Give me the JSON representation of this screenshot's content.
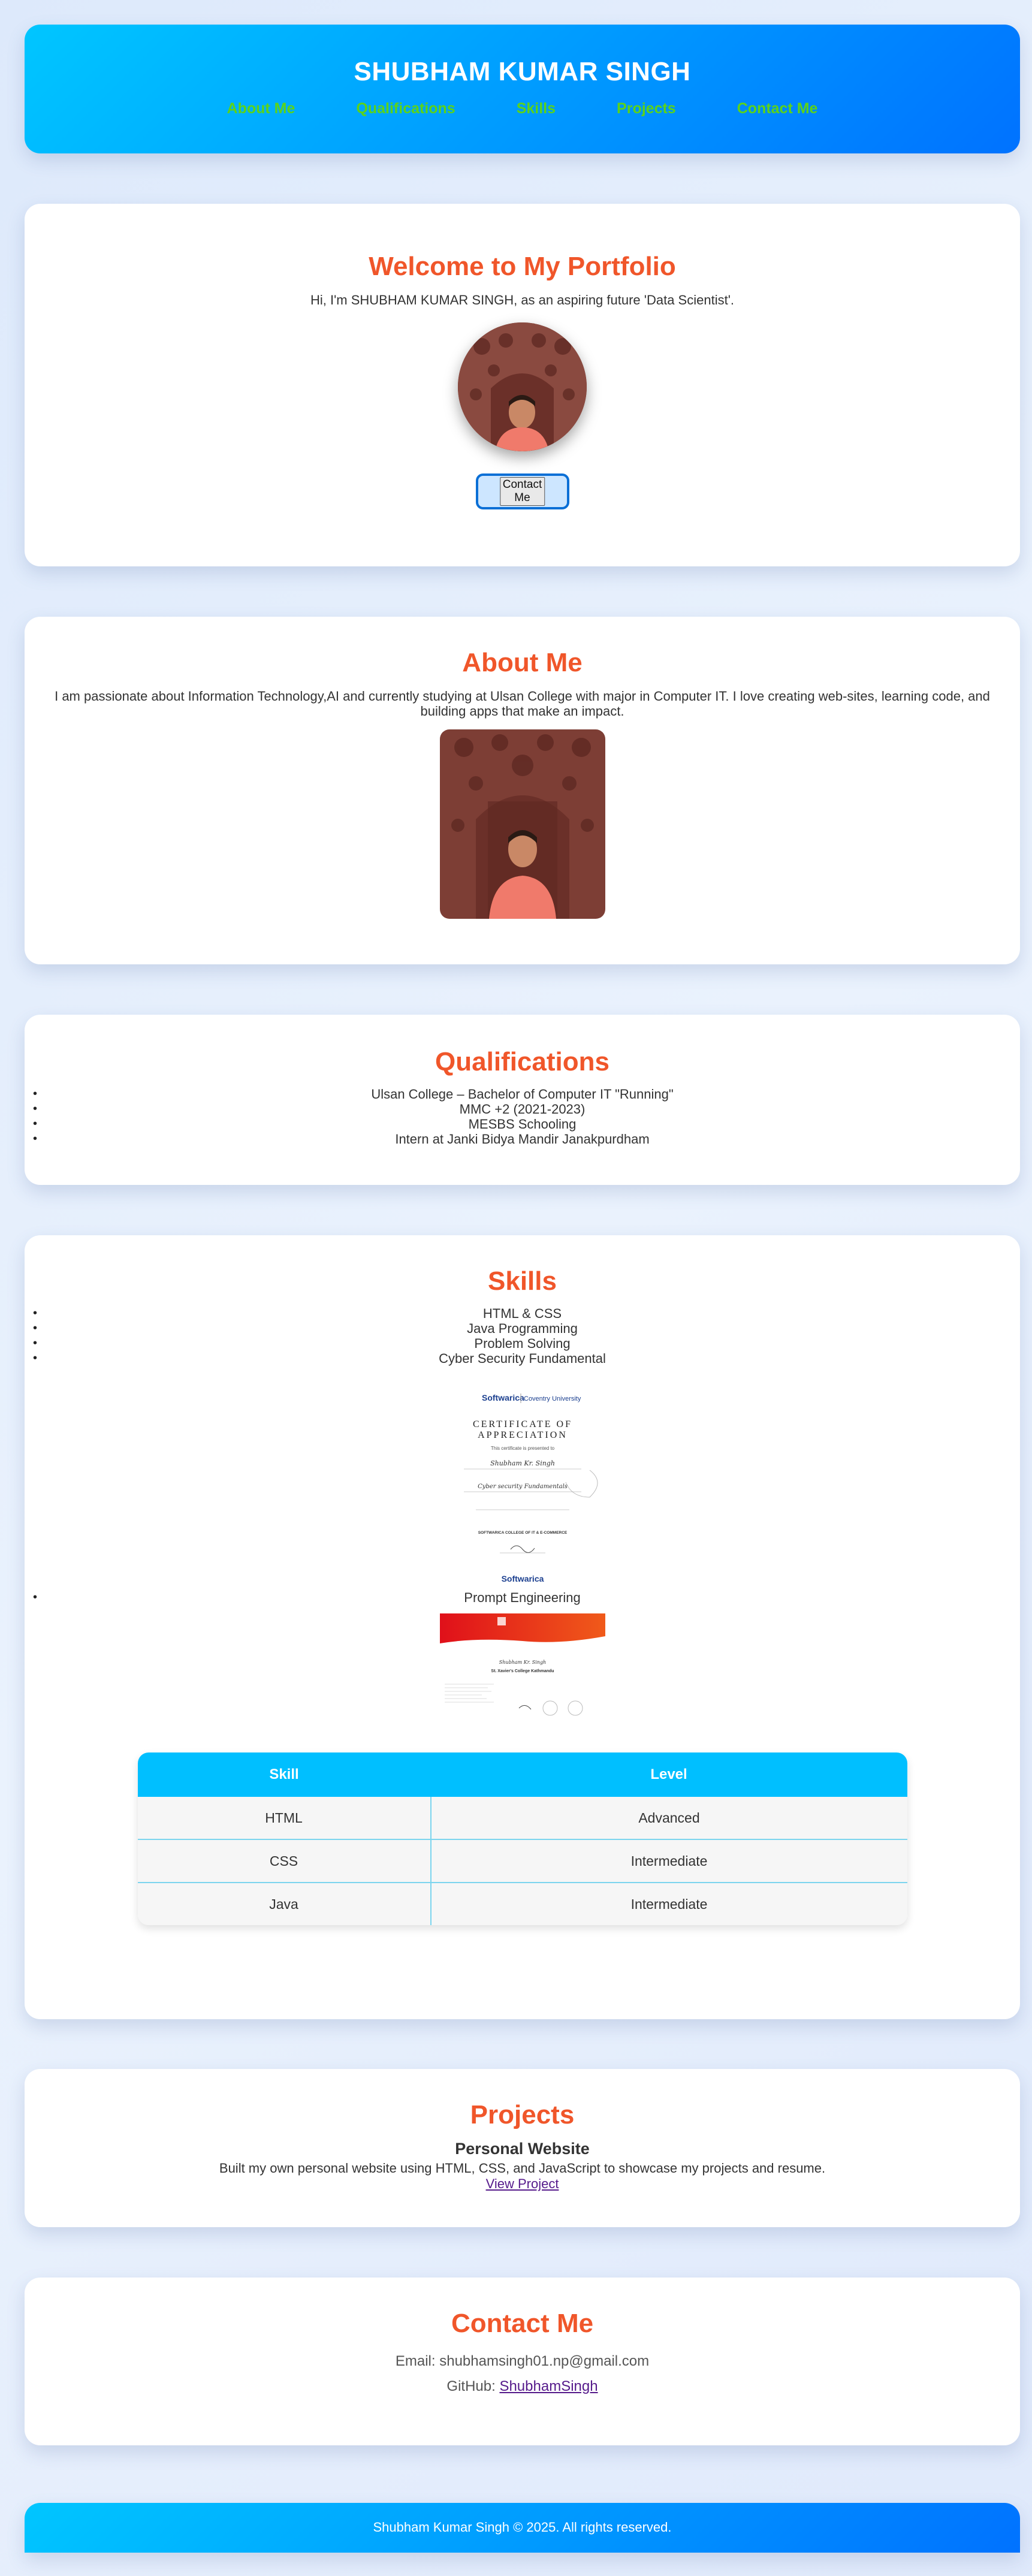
{
  "header": {
    "title": "SHUBHAM KUMAR SINGH",
    "nav": [
      "About Me",
      "Qualifications",
      "Skills",
      "Projects",
      "Contact Me"
    ]
  },
  "welcome": {
    "heading": "Welcome to My Portfolio",
    "intro": "Hi, I'm SHUBHAM KUMAR SINGH, as an aspiring future 'Data Scientist'.",
    "button_label": "Contact Me"
  },
  "about": {
    "heading": "About Me",
    "text": "I am passionate about Information Technology,AI and currently studying at Ulsan College with major in Computer IT. I love creating web-sites, learning code, and building apps that make an impact."
  },
  "qualifications": {
    "heading": "Qualifications",
    "items": [
      "Ulsan College – Bachelor of Computer IT \"Running\"",
      "MMC +2 (2021-2023)",
      "MESBS Schooling",
      "Intern at Janki Bidya Mandir Janakpurdham"
    ]
  },
  "skills": {
    "heading": "Skills",
    "items": [
      "HTML & CSS",
      "Java Programming",
      "Problem Solving",
      "Cyber Security Fundamental"
    ],
    "extra_item": "Prompt Engineering",
    "cert1": {
      "brand": "Softwarica",
      "partner": "Coventry University",
      "title1": "CERTIFICATE OF",
      "title2": "APPRECIATION",
      "line": "This certificate is presented to",
      "name": "Shubham Kr. Singh",
      "course": "Cyber security Fundamentals",
      "footer": "SOFTWARICA COLLEGE OF IT & E-COMMERCE"
    },
    "cert2": {
      "name": "Shubham Kr. Singh",
      "college": "St. Xavier's College Kathmandu"
    },
    "table": {
      "headers": [
        "Skill",
        "Level"
      ],
      "rows": [
        [
          "HTML",
          "Advanced"
        ],
        [
          "CSS",
          "Intermediate"
        ],
        [
          "Java",
          "Intermediate"
        ]
      ]
    }
  },
  "projects": {
    "heading": "Projects",
    "title": "Personal Website",
    "description": "Built my own personal website using HTML, CSS, and JavaScript to showcase my projects and resume.",
    "link": "View Project"
  },
  "contact": {
    "heading": "Contact Me",
    "email_label": "Email: shubhamsingh01.np@gmail.com",
    "github_prefix": "GitHub: ",
    "github_link": "ShubhamSingh"
  },
  "footer": {
    "text": "Shubham Kumar Singh © 2025. All rights reserved."
  },
  "colors": {
    "accent": "#f0562a",
    "nav": "#5bd31a",
    "gradient_start": "#00c6ff",
    "gradient_end": "#0072ff",
    "table_header": "#00bfff"
  }
}
